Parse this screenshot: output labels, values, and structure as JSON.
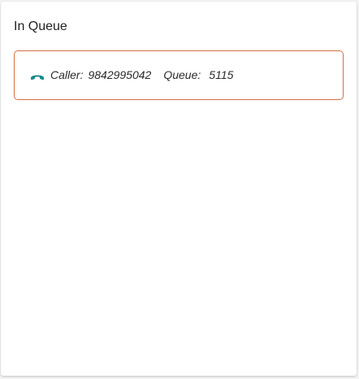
{
  "panel": {
    "title": "In Queue"
  },
  "queue_items": [
    {
      "icon": "phone-hangup-icon",
      "caller_label": "Caller:",
      "caller_number": "9842995042",
      "queue_label": "Queue:",
      "queue_number": "5115"
    }
  ],
  "colors": {
    "card_border": "#d2703f",
    "phone_icon": "#1a8a8a"
  }
}
